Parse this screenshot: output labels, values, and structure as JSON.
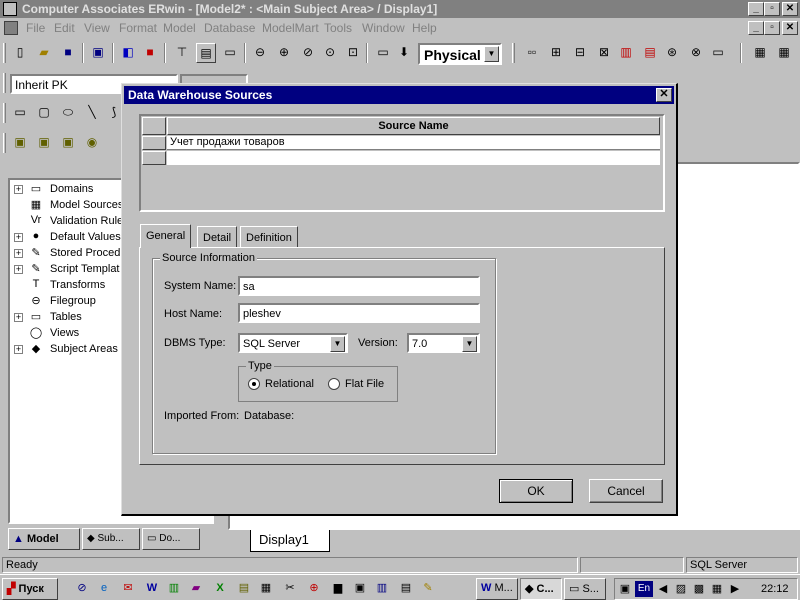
{
  "app": {
    "title": "Computer Associates ERwin - [Model2* : <Main Subject Area> / Display1]",
    "minimize": "_",
    "maximize": "▫",
    "close": "✕"
  },
  "menu": [
    "File",
    "Edit",
    "View",
    "Format",
    "Model",
    "Database",
    "ModelMart",
    "Tools",
    "Window",
    "Help"
  ],
  "toolbar": {
    "model_mode": "Physical",
    "display_combo": "Inherit PK"
  },
  "tree": {
    "items": [
      {
        "label": "Domains",
        "icon": "domain-icon",
        "glyph": "▭",
        "expandable": true
      },
      {
        "label": "Model Sources",
        "icon": "model-sources-icon",
        "glyph": "▦",
        "expandable": false
      },
      {
        "label": "Validation Rule",
        "icon": "validation-rule-icon",
        "glyph": "Vr",
        "expandable": false
      },
      {
        "label": "Default Values",
        "icon": "default-values-icon",
        "glyph": "●",
        "expandable": true
      },
      {
        "label": "Stored Proced",
        "icon": "stored-procedure-icon",
        "glyph": "✎",
        "expandable": true
      },
      {
        "label": "Script Templat",
        "icon": "script-template-icon",
        "glyph": "✎",
        "expandable": true
      },
      {
        "label": "Transforms",
        "icon": "transforms-icon",
        "glyph": "T",
        "expandable": false
      },
      {
        "label": "Filegroup",
        "icon": "filegroup-icon",
        "glyph": "⊖",
        "expandable": false
      },
      {
        "label": "Tables",
        "icon": "tables-icon",
        "glyph": "▭",
        "expandable": true
      },
      {
        "label": "Views",
        "icon": "views-icon",
        "glyph": "◯",
        "expandable": false
      },
      {
        "label": "Subject Areas",
        "icon": "subject-areas-icon",
        "glyph": "◆",
        "expandable": true
      }
    ],
    "tabs": [
      "Model",
      "Sub...",
      "Do..."
    ]
  },
  "diagram": {
    "tab": "Display1"
  },
  "dialog": {
    "title": "Data Warehouse Sources",
    "close": "✕",
    "grid_header": "Source Name",
    "grid_rows": [
      "Учет продажи товаров",
      ""
    ],
    "tabs": [
      "General",
      "Detail",
      "Definition"
    ],
    "group_title": "Source Information",
    "system_name_label": "System Name:",
    "system_name_value": "sa",
    "host_name_label": "Host Name:",
    "host_name_value": "pleshev",
    "dbms_type_label": "DBMS Type:",
    "dbms_type_value": "SQL Server",
    "version_label": "Version:",
    "version_value": "7.0",
    "type_group_title": "Type",
    "type_relational": "Relational",
    "type_flat_file": "Flat File",
    "imported_from_label": "Imported From:",
    "imported_from_value": "Database:",
    "ok": "OK",
    "cancel": "Cancel"
  },
  "status": {
    "left": "Ready",
    "right": "SQL Server"
  },
  "taskbar": {
    "start": "Пуск",
    "tasks": [
      "M...",
      "C...",
      "S..."
    ],
    "lang": "En",
    "clock": "22:12"
  }
}
